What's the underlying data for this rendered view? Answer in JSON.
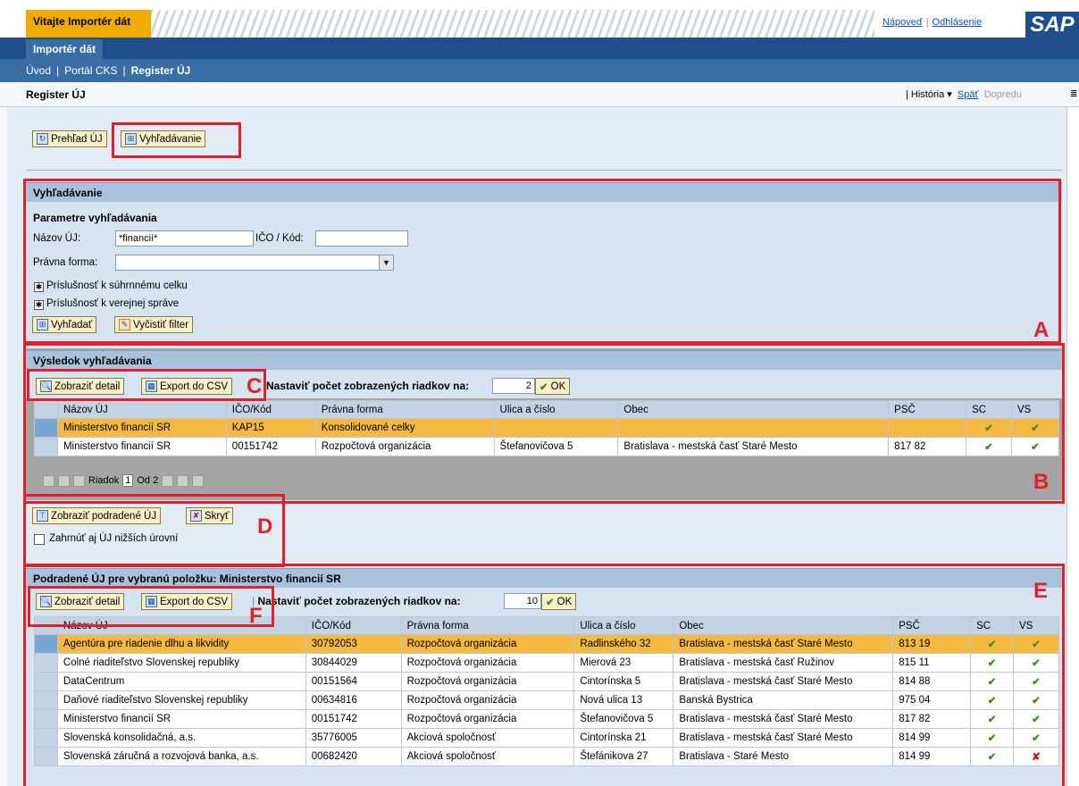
{
  "header": {
    "welcome": "Vitajte Importér dát",
    "help": "Nápoveď",
    "logout": "Odhlásenie",
    "logo": "SAP"
  },
  "nav": {
    "tab": "Importér dát",
    "crumbs": [
      "Úvod",
      "Portál CKS",
      "Register ÚJ"
    ]
  },
  "page": {
    "title": "Register ÚJ",
    "history": "História",
    "back": "Späť",
    "forward": "Dopredu"
  },
  "toolbar": {
    "overview": "Prehľad ÚJ",
    "search": "Vyhľadávanie"
  },
  "search": {
    "head": "Vyhľadávanie",
    "params": "Parametre vyhľadávania",
    "name_label": "Názov ÚJ:",
    "name_value": "*financií*",
    "ico_label": "IČO / Kód:",
    "ico_value": "",
    "legal_label": "Právna forma:",
    "legal_value": "",
    "chk1": "Príslušnosť k súhrnnému celku",
    "chk2": "Príslušnosť k verejnej správe",
    "btn_search": "Vyhľadať",
    "btn_clear": "Vyčistiť filter"
  },
  "results": {
    "head": "Výsledok vyhľadávania",
    "detail": "Zobraziť detail",
    "export": "Export do CSV",
    "rows_label": "Nastaviť počet zobrazených riadkov na:",
    "rows_value": "2",
    "ok": "OK",
    "columns": [
      "Názov ÚJ",
      "IČO/Kód",
      "Právna forma",
      "Ulica a číslo",
      "Obec",
      "PSČ",
      "SC",
      "VS"
    ],
    "rows": [
      [
        "Ministerstvo financií SR",
        "KAP15",
        "Konsolidované celky",
        "",
        "",
        "",
        "✔",
        "✔"
      ],
      [
        "Ministerstvo financií SR",
        "00151742",
        "Rozpočtová organizácia",
        "Štefanovičova 5",
        "Bratislava - mestská časť Staré Mesto",
        "817 82",
        "✔",
        "✔"
      ]
    ],
    "pager": {
      "row_label": "Riadok",
      "row_value": "1",
      "of_label": "Od 2"
    }
  },
  "sub": {
    "show_sub": "Zobraziť podradené ÚJ",
    "hide": "Skryť",
    "include": "Zahrnúť aj ÚJ nižších úrovní"
  },
  "child": {
    "head": "Podradené ÚJ pre vybranú položku: Ministerstvo financií SR",
    "detail": "Zobraziť detail",
    "export": "Export do CSV",
    "rows_label": "Nastaviť počet zobrazených riadkov na:",
    "rows_value": "10",
    "ok": "OK",
    "columns": [
      "Názov ÚJ",
      "IČO/Kód",
      "Právna forma",
      "Ulica a číslo",
      "Obec",
      "PSČ",
      "SC",
      "VS"
    ],
    "rows": [
      [
        "Agentúra pre riadenie dlhu a likvidity",
        "30792053",
        "Rozpočtová organizácia",
        "Radlinského 32",
        "Bratislava - mestská časť Staré Mesto",
        "813 19",
        "✔",
        "✔"
      ],
      [
        "Colné riaditeľstvo Slovenskej republiky",
        "30844029",
        "Rozpočtová organizácia",
        "Mierová 23",
        "Bratislava - mestská časť Ružinov",
        "815 11",
        "✔",
        "✔"
      ],
      [
        "DataCentrum",
        "00151564",
        "Rozpočtová organizácia",
        "Cintorínska 5",
        "Bratislava - mestská časť Staré Mesto",
        "814 88",
        "✔",
        "✔"
      ],
      [
        "Daňové riaditeľstvo Slovenskej republiky",
        "00634816",
        "Rozpočtová organizácia",
        "Nová ulica 13",
        "Banská Bystrica",
        "975 04",
        "✔",
        "✔"
      ],
      [
        "Ministerstvo financií SR",
        "00151742",
        "Rozpočtová organizácia",
        "Štefanovičova 5",
        "Bratislava - mestská časť Staré Mesto",
        "817 82",
        "✔",
        "✔"
      ],
      [
        "Slovenská konsolidačná, a.s.",
        "35776005",
        "Akciová spoločnosť",
        "Cintorínska 21",
        "Bratislava - mestská časť Staré Mesto",
        "814 99",
        "✔",
        "✔"
      ],
      [
        "Slovenská záručná a rozvojová banka, a.s.",
        "00682420",
        "Akciová spoločnosť",
        "Štefánikova 27",
        "Bratislava - Staré Mesto",
        "814 99",
        "✔",
        "✘"
      ]
    ]
  },
  "annotations": [
    "A",
    "B",
    "C",
    "D",
    "E",
    "F"
  ]
}
